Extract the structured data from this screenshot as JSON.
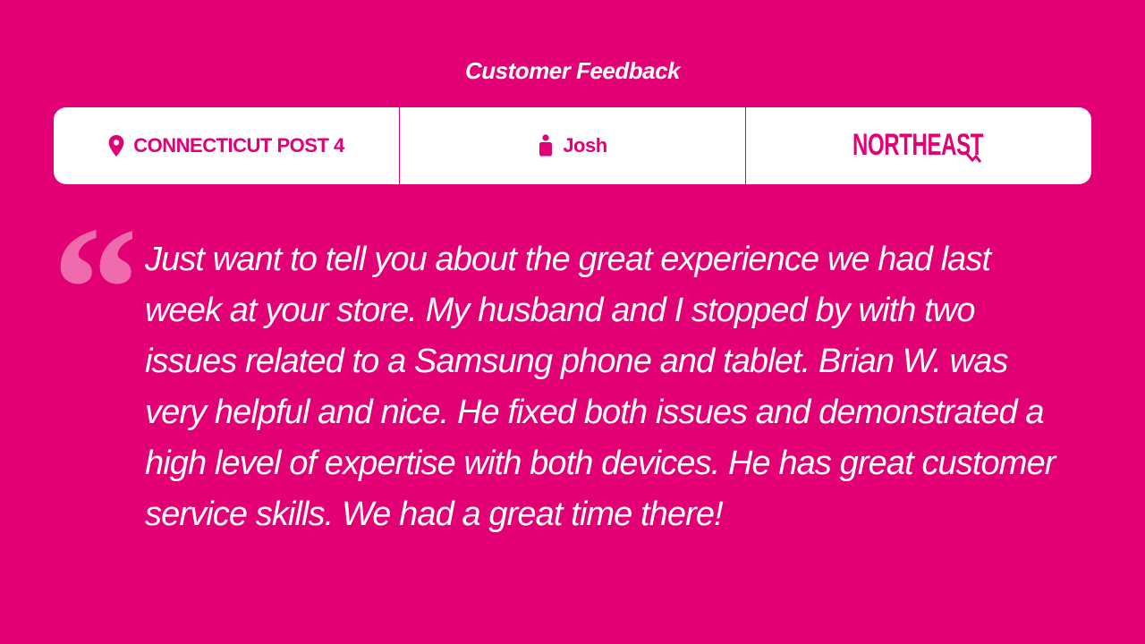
{
  "header": {
    "title": "Customer Feedback"
  },
  "info_bar": {
    "location": {
      "icon": "location-pin-icon",
      "label": "CONNECTICUT POST 4"
    },
    "employee": {
      "icon": "person-icon",
      "name": "Josh"
    },
    "brand": {
      "logo_text": "NORTHEAST"
    }
  },
  "feedback": {
    "quote": "Just want to tell you about the great experience we had last week at your store. My husband and I stopped by with two issues related to a Samsung phone and tablet. Brian W. was very helpful and nice. He fixed both issues and demonstrated a high level of expertise with both devices. He has great customer service skills. We had a great time there!"
  },
  "colors": {
    "background": "#E20074",
    "panel": "#FFFFFF",
    "text_on_background": "#FFFFFF",
    "quote_mark": "#F06AAE"
  }
}
